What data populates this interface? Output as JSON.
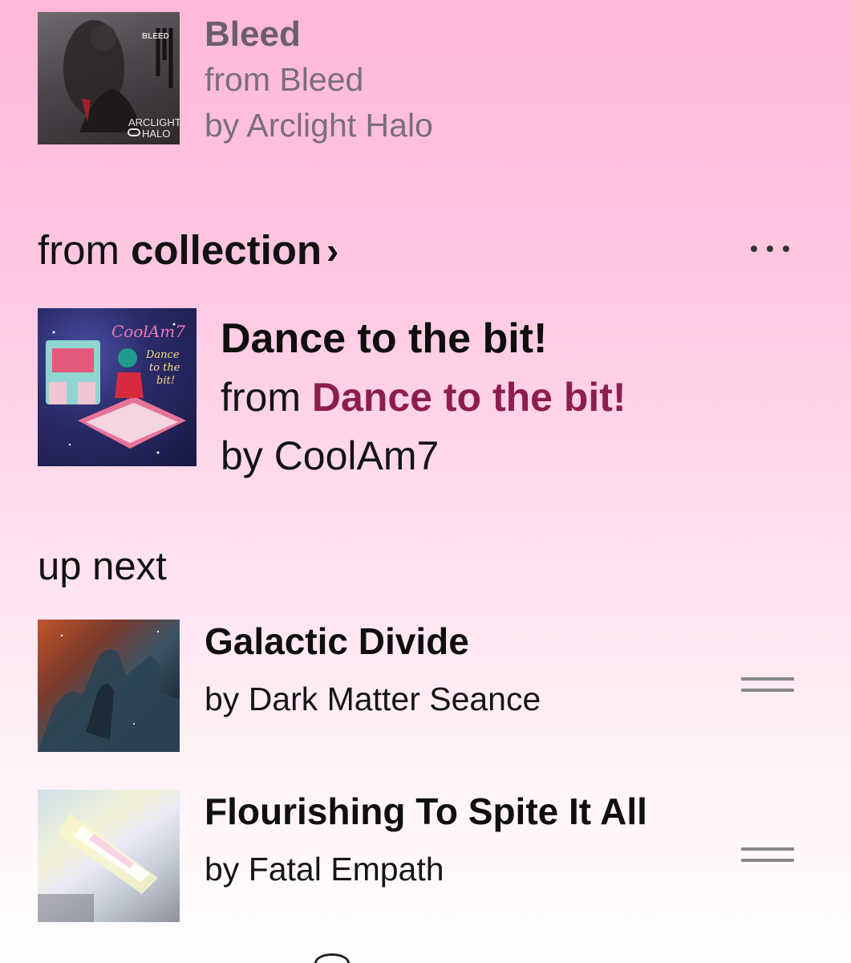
{
  "previous_track": {
    "title": "Bleed",
    "album": "from Bleed",
    "artist": "by Arclight Halo",
    "artwork": {
      "text_top": "BLEED",
      "text_bottom_1": "ARCLIGHT",
      "text_bottom_2": "HALO"
    }
  },
  "collection_header": {
    "prefix": "from",
    "label": "collection",
    "chevron": "›",
    "more_icon": "more-horizontal-icon"
  },
  "current_track": {
    "title": "Dance to the bit!",
    "album_prefix": "from ",
    "album_link": "Dance to the bit!",
    "artist": "by CoolAm7",
    "link_color": "#8c1e4e",
    "artwork": {
      "script_title": "CoolAm7",
      "script_sub": "Dance to the bit!"
    }
  },
  "up_next": {
    "label": "up next",
    "items": [
      {
        "title": "Galactic Divide",
        "artist": "by Dark Matter Seance",
        "handle_icon": "drag-handle-icon"
      },
      {
        "title": "Flourishing To Spite It All",
        "artist": "by Fatal Empath",
        "handle_icon": "drag-handle-icon"
      }
    ]
  },
  "colors": {
    "background_top": "#ffb8d8",
    "background_bottom": "#ffffff"
  }
}
